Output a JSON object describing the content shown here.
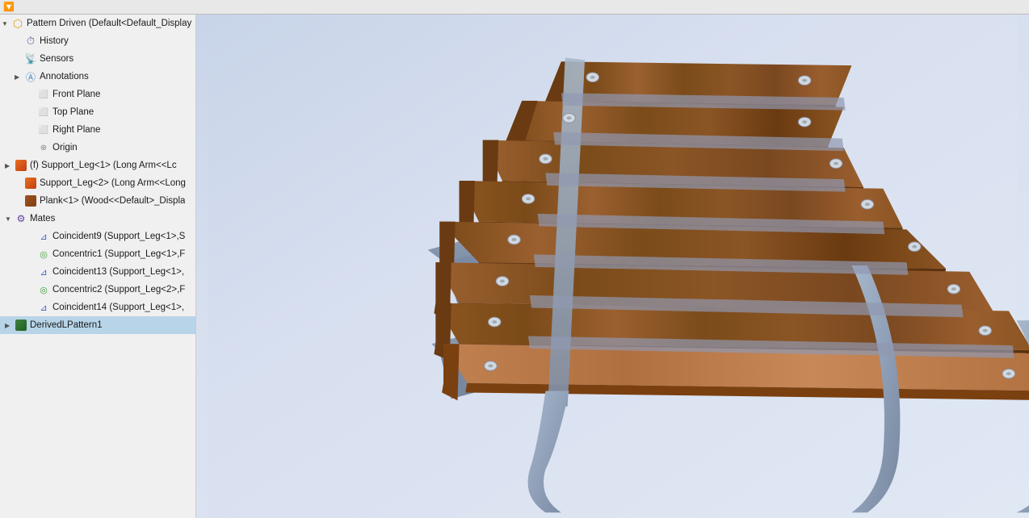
{
  "toolbar": {
    "filter_label": "▼"
  },
  "sidebar": {
    "root_label": "Pattern Driven  (Default<Default_Display",
    "items": [
      {
        "id": "history",
        "label": "History",
        "indent": 1,
        "icon": "history",
        "expandable": false
      },
      {
        "id": "sensors",
        "label": "Sensors",
        "indent": 1,
        "icon": "sensor",
        "expandable": false
      },
      {
        "id": "annotations",
        "label": "Annotations",
        "indent": 1,
        "icon": "annotation",
        "expandable": true
      },
      {
        "id": "front-plane",
        "label": "Front Plane",
        "indent": 2,
        "icon": "plane",
        "expandable": false
      },
      {
        "id": "top-plane",
        "label": "Top Plane",
        "indent": 2,
        "icon": "plane",
        "expandable": false
      },
      {
        "id": "right-plane",
        "label": "Right Plane",
        "indent": 2,
        "icon": "plane",
        "expandable": false
      },
      {
        "id": "origin",
        "label": "Origin",
        "indent": 2,
        "icon": "origin",
        "expandable": false
      },
      {
        "id": "support-leg1",
        "label": "(f) Support_Leg<1> (Long Arm<<Lc",
        "indent": 1,
        "icon": "part-orange",
        "expandable": true
      },
      {
        "id": "support-leg2",
        "label": "Support_Leg<2> (Long Arm<<Long",
        "indent": 1,
        "icon": "part-orange",
        "expandable": false
      },
      {
        "id": "plank1",
        "label": "Plank<1> (Wood<<Default>_Displa",
        "indent": 1,
        "icon": "part-brown",
        "expandable": false
      },
      {
        "id": "mates",
        "label": "Mates",
        "indent": 0,
        "icon": "mates",
        "expandable": true
      },
      {
        "id": "coincident9",
        "label": "Coincident9 (Support_Leg<1>,S",
        "indent": 2,
        "icon": "coincident",
        "expandable": false
      },
      {
        "id": "concentric1",
        "label": "Concentric1 (Support_Leg<1>,F",
        "indent": 2,
        "icon": "concentric",
        "expandable": false
      },
      {
        "id": "coincident13",
        "label": "Coincident13 (Support_Leg<1>,",
        "indent": 2,
        "icon": "coincident",
        "expandable": false
      },
      {
        "id": "concentric2",
        "label": "Concentric2 (Support_Leg<2>,F",
        "indent": 2,
        "icon": "concentric",
        "expandable": false
      },
      {
        "id": "coincident14",
        "label": "Coincident14 (Support_Leg<1>,",
        "indent": 2,
        "icon": "coincident",
        "expandable": false
      },
      {
        "id": "derived-pattern",
        "label": "DerivedLPattern1",
        "indent": 1,
        "icon": "pattern",
        "expandable": true,
        "selected": true
      }
    ]
  }
}
